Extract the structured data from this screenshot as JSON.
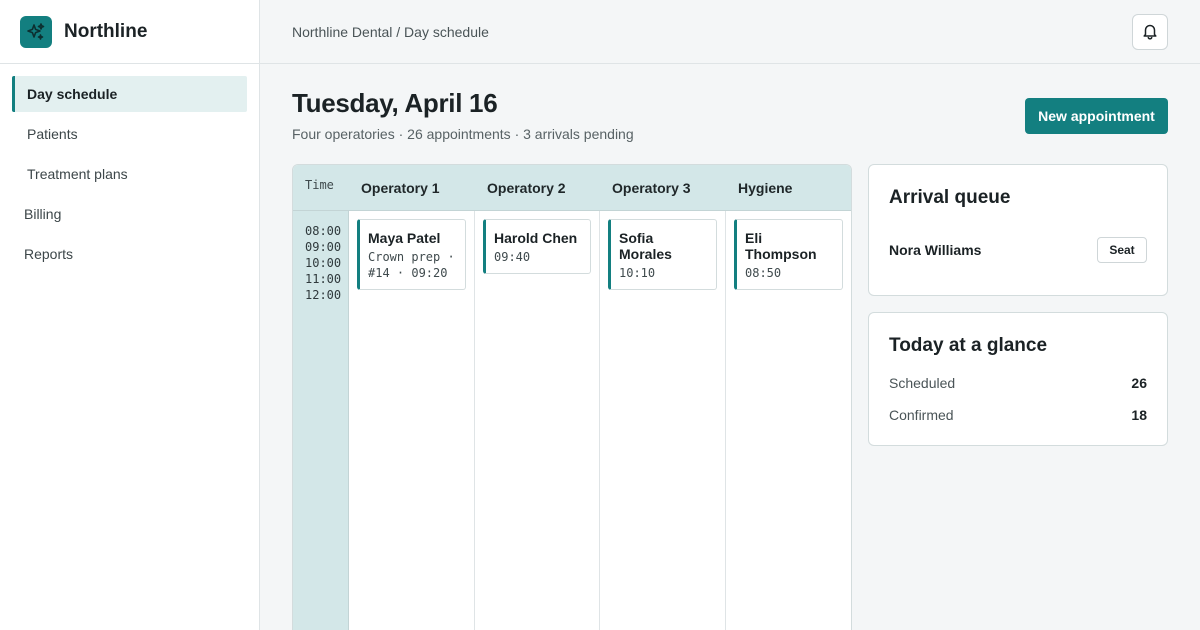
{
  "app": {
    "name": "Northline"
  },
  "sidebar": {
    "items": [
      {
        "label": "Day schedule"
      },
      {
        "label": "Patients"
      },
      {
        "label": "Treatment plans"
      },
      {
        "label": "Billing"
      },
      {
        "label": "Reports"
      }
    ]
  },
  "header": {
    "breadcrumb": "Northline Dental / Day schedule"
  },
  "page": {
    "title": "Tuesday, April 16",
    "subtitle": "Four operatories · 26 appointments · 3 arrivals pending",
    "new_appointment_label": "New appointment"
  },
  "schedule": {
    "time_header": "Time",
    "times": [
      "08:00",
      "09:00",
      "10:00",
      "11:00",
      "12:00"
    ],
    "columns": [
      {
        "name": "Operatory 1",
        "appointment": {
          "patient": "Maya Patel",
          "detail": "Crown prep ·",
          "detail2": "#14 · 09:20"
        }
      },
      {
        "name": "Operatory 2",
        "appointment": {
          "patient": "Harold Chen",
          "detail": "09:40"
        }
      },
      {
        "name": "Operatory 3",
        "appointment": {
          "patient": "Sofia Morales",
          "detail": "10:10"
        }
      },
      {
        "name": "Hygiene",
        "appointment": {
          "patient": "Eli Thompson",
          "detail": "08:50"
        }
      }
    ]
  },
  "arrival_queue": {
    "title": "Arrival queue",
    "items": [
      {
        "name": "Nora Williams",
        "action": "Seat"
      }
    ]
  },
  "glance": {
    "title": "Today at a glance",
    "stats": [
      {
        "label": "Scheduled",
        "value": "26"
      },
      {
        "label": "Confirmed",
        "value": "18"
      }
    ]
  },
  "colors": {
    "accent": "#137f80",
    "grid_header": "#d3e7e8",
    "active_nav_bg": "#e3f0f0"
  },
  "icons": {
    "logo": "sparkle-icon",
    "notifications": "bell-icon"
  }
}
